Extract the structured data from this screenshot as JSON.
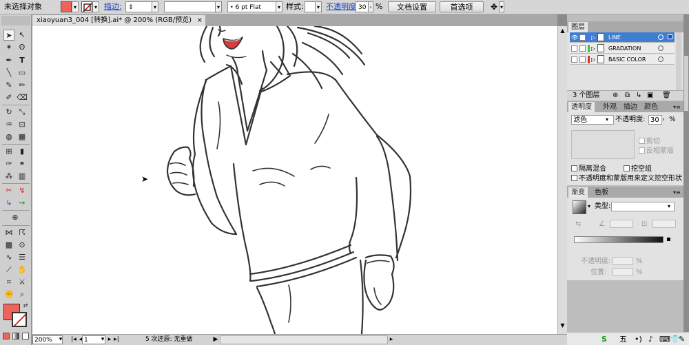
{
  "control_bar": {
    "selection_status": "未选择对象",
    "fill_color": "#f0635a",
    "stroke_label": "描边:",
    "brush_label": "6 pt Flat",
    "style_label": "样式:",
    "opacity_label": "不透明度:",
    "opacity_value": "30",
    "percent": "%",
    "doc_setup_button": "文档设置",
    "preferences_button": "首选项"
  },
  "document": {
    "tab_title": "xiaoyuan3_004 [转换].ai* @ 200% (RGB/预览)",
    "tab_close": "×"
  },
  "status_bar": {
    "zoom": "200%",
    "artboard": "1",
    "undo_status": "5 次还原: 无重做"
  },
  "layers_panel": {
    "tab": "图层",
    "layers": [
      {
        "name": "LINE",
        "color": "#4f6cff",
        "selected": true
      },
      {
        "name": "GRADATION",
        "color": "#35c43a",
        "selected": false
      },
      {
        "name": "BASIC COLOR",
        "color": "#e03131",
        "selected": false
      }
    ],
    "count_label": "3 个图层"
  },
  "transparency_panel": {
    "tabs": [
      "透明度",
      "外观",
      "描边",
      "颜色"
    ],
    "blend_mode": "滤色",
    "opacity_label": "不透明度:",
    "opacity_value": "30",
    "clip_label": "剪切",
    "invert_mask_label": "反相蒙版",
    "isolate_blending_label": "隔离混合",
    "knockout_group_label": "挖空组",
    "opacity_mask_label": "不透明度和蒙版用来定义挖空形状"
  },
  "gradient_panel": {
    "tabs": [
      "渐变",
      "色板"
    ],
    "type_label": "类型:",
    "opacity_label": "不透明度:",
    "position_label": "位置:",
    "percent": "%"
  },
  "taskbar": {
    "ime_label": "五"
  }
}
